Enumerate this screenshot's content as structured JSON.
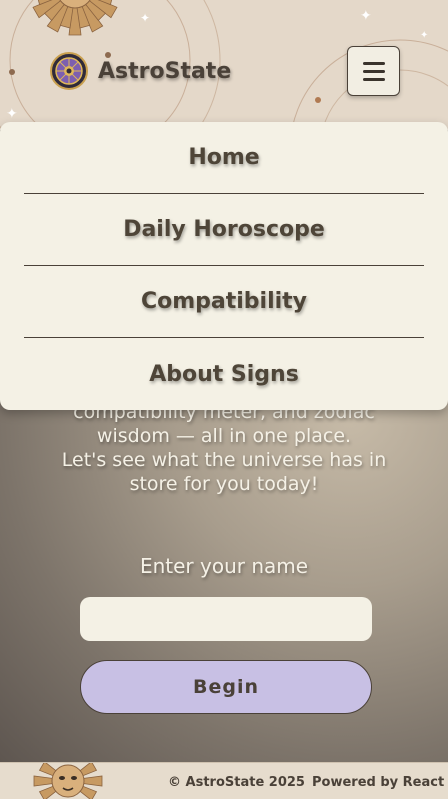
{
  "header": {
    "brand_name": "AstroState",
    "logo_icon": "zodiac-wheel-icon",
    "menu_icon": "hamburger-menu-icon"
  },
  "dropdown": {
    "items": [
      {
        "label": "Home"
      },
      {
        "label": "Daily Horoscope"
      },
      {
        "label": "Compatibility"
      },
      {
        "label": "About Signs"
      }
    ]
  },
  "main": {
    "intro_lines": [
      "compatibility meter, and zodiac",
      "wisdom — all in one place.",
      "Let's see what the universe has in",
      "store for you today!"
    ],
    "name_label": "Enter your name",
    "name_value": "",
    "begin_label": "Begin"
  },
  "footer": {
    "copyright": "© AstroState 2025",
    "powered": "Powered by React"
  },
  "colors": {
    "accent_lavender": "#c8c0e4",
    "cream": "#f4f1e5",
    "text_brown": "#4a4138"
  }
}
